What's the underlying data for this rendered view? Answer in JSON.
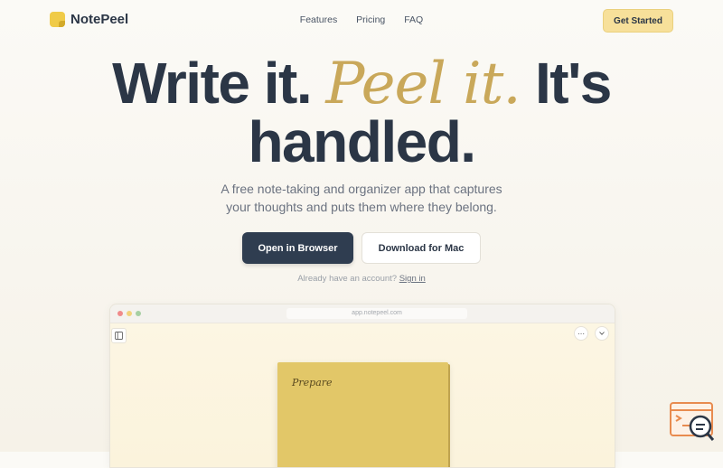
{
  "header": {
    "brand": "NotePeel",
    "nav": [
      "Features",
      "Pricing",
      "FAQ"
    ],
    "cta": "Get Started"
  },
  "hero": {
    "line1_part1": "Write it.",
    "line1_accent": "Peel it.",
    "line1_part2": "It's",
    "line2": "handled.",
    "subtitle_line1": "A free note-taking and organizer app that captures",
    "subtitle_line2": "your thoughts and puts them where they belong.",
    "primary_button": "Open in Browser",
    "secondary_button": "Download for Mac",
    "account_prompt": "Already have an account?",
    "sign_in": "Sign in"
  },
  "preview": {
    "url": "app.notepeel.com",
    "note_text": "Prepare"
  },
  "colors": {
    "brand_yellow": "#f0cb48",
    "accent_gold": "#c9a85a",
    "primary_navy": "#2f3d50",
    "cta_bg": "#f7e09a"
  },
  "icons": [
    "notepeel-logo-icon",
    "sidebar-toggle-icon",
    "more-icon",
    "chevron-down-icon",
    "support-widget-icon"
  ]
}
